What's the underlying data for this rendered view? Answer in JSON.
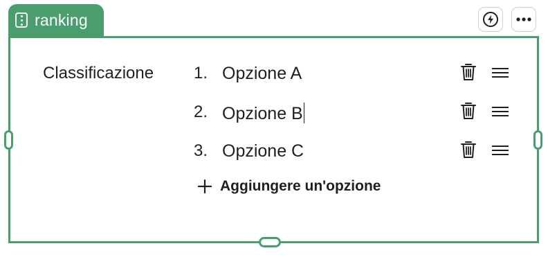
{
  "block": {
    "type_label": "ranking",
    "accent_color": "#4a9e6d"
  },
  "toolbar": {
    "bolt_icon": "lightning-icon",
    "more_icon": "more-icon"
  },
  "field": {
    "label": "Classificazione"
  },
  "options": [
    {
      "number": "1.",
      "text": "Opzione A"
    },
    {
      "number": "2.",
      "text": "Opzione B"
    },
    {
      "number": "3.",
      "text": "Opzione C"
    }
  ],
  "add_option": {
    "label": "Aggiungere un'opzione"
  }
}
